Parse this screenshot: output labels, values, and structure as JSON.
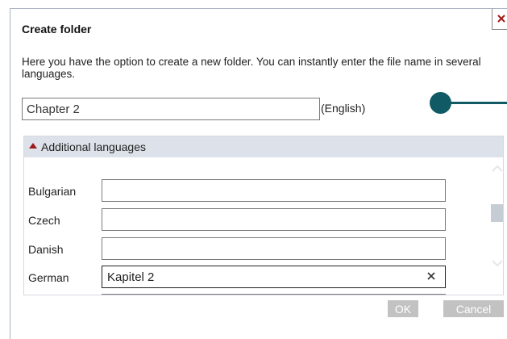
{
  "dialog": {
    "title": "Create folder",
    "description": "Here you have the option to create a new folder. You can instantly enter the file name in several languages.",
    "folder_name_value": "Chapter 2",
    "folder_name_language": "(English)"
  },
  "additional_languages": {
    "header": "Additional languages",
    "rows": [
      {
        "label": "Bulgarian",
        "value": ""
      },
      {
        "label": "Czech",
        "value": ""
      },
      {
        "label": "Danish",
        "value": ""
      },
      {
        "label": "German",
        "value": "Kapitel 2"
      }
    ]
  },
  "buttons": {
    "ok": "OK",
    "cancel": "Cancel"
  },
  "icons": {
    "close": "close-icon",
    "collapse": "triangle-up-icon",
    "clear": "clear-x-icon",
    "scroll_up": "chevron-up-icon",
    "scroll_down": "chevron-down-icon"
  },
  "colors": {
    "callout": "#0f5a64",
    "panel_header_bg": "#dde2ea",
    "triangle": "#9b1b1b",
    "button_bg": "#c2c2c2"
  }
}
